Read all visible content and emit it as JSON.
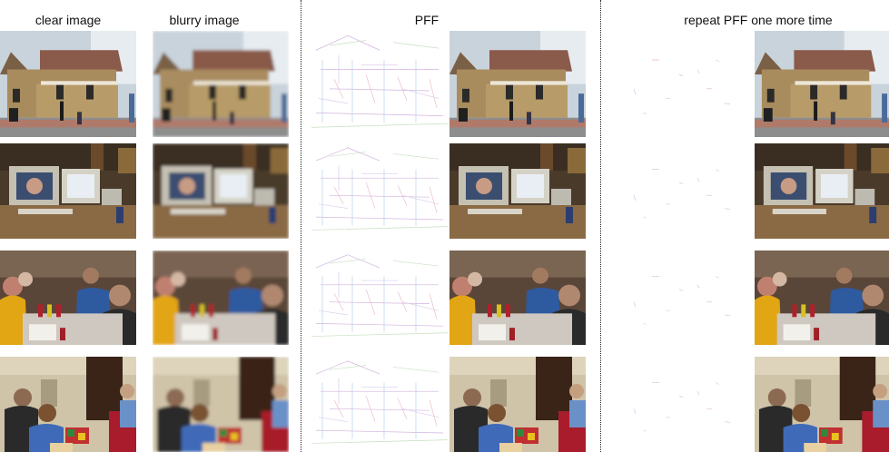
{
  "headers": {
    "clear": "clear image",
    "blurry": "blurry image",
    "pff": "PFF",
    "repeat": "repeat PFF one more time"
  },
  "rows": [
    "house",
    "computer-desk",
    "dinner-party",
    "living-room"
  ],
  "columns": [
    "clear",
    "blurry",
    "pff-residual",
    "pff-result",
    "repeat-residual",
    "repeat-result"
  ]
}
